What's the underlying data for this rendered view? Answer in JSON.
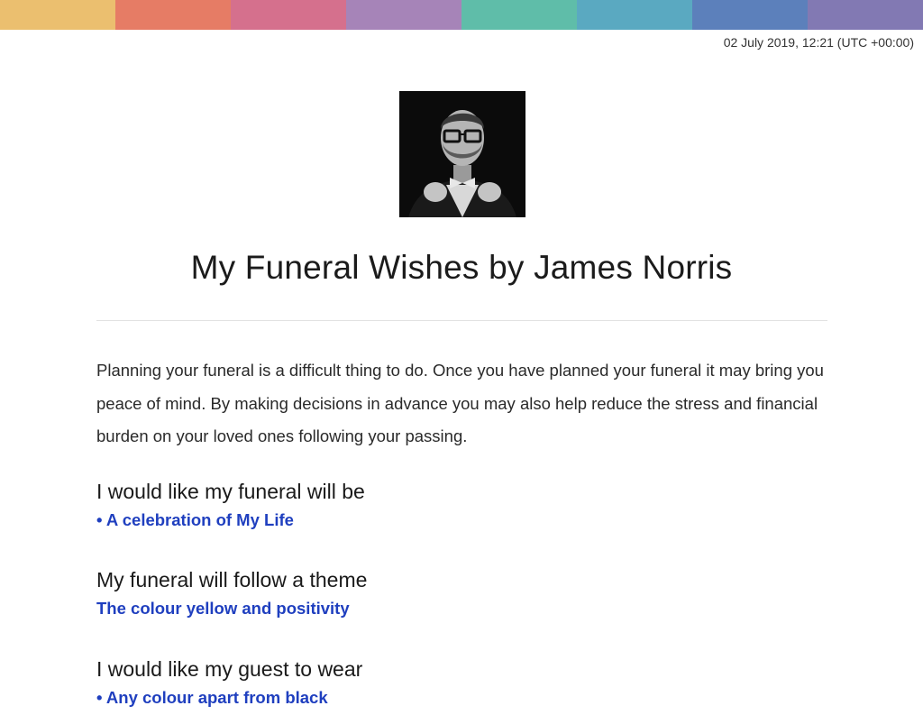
{
  "header": {
    "bar_colors": [
      "#ebbf6f",
      "#e67c65",
      "#d5708d",
      "#a684b8",
      "#5fbda9",
      "#5aa9c1",
      "#5c80bb",
      "#8279b3"
    ],
    "timestamp": "02 July 2019, 12:21 (UTC +00:00)"
  },
  "profile": {
    "photo_icon": "portrait-photo"
  },
  "page": {
    "title": "My Funeral Wishes by James Norris",
    "intro": "Planning your funeral is a difficult thing to do. Once you have planned your funeral it may bring you peace of mind. By making decisions in advance you may also help reduce the stress and financial burden on your loved ones following your passing."
  },
  "sections": [
    {
      "heading": "I would like my funeral will be",
      "answer": "• A celebration of My Life"
    },
    {
      "heading": "My funeral will follow a theme",
      "answer": "The colour yellow and positivity"
    },
    {
      "heading": "I would like my guest to wear",
      "answer": "• Any colour apart from black"
    }
  ],
  "colors": {
    "answer_text": "#1f3fbf"
  }
}
